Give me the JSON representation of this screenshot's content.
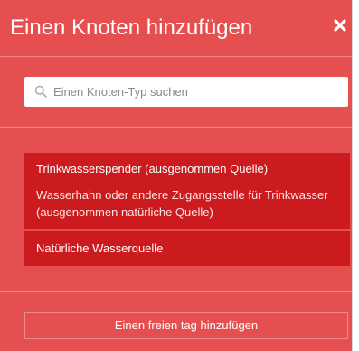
{
  "header": {
    "title": "Einen Knoten hinzufügen",
    "close_icon": "close-icon"
  },
  "search": {
    "placeholder": "Einen Knoten-Typ suchen",
    "value": "",
    "icon": "search-icon"
  },
  "results": [
    {
      "name": "Trinkwasserspender (ausgenommen Quelle)",
      "description": "Wasserhahn oder andere Zugangsstelle für Trinkwasser (ausgenommen natürliche Quelle)"
    },
    {
      "name": "Natürliche Wasserquelle"
    }
  ],
  "footer": {
    "add_tag_label": "Einen freien tag hinzufügen"
  },
  "colors": {
    "panel_background": "#e54f4f",
    "item_background": "#cc1b1f",
    "text": "#ffffff"
  }
}
